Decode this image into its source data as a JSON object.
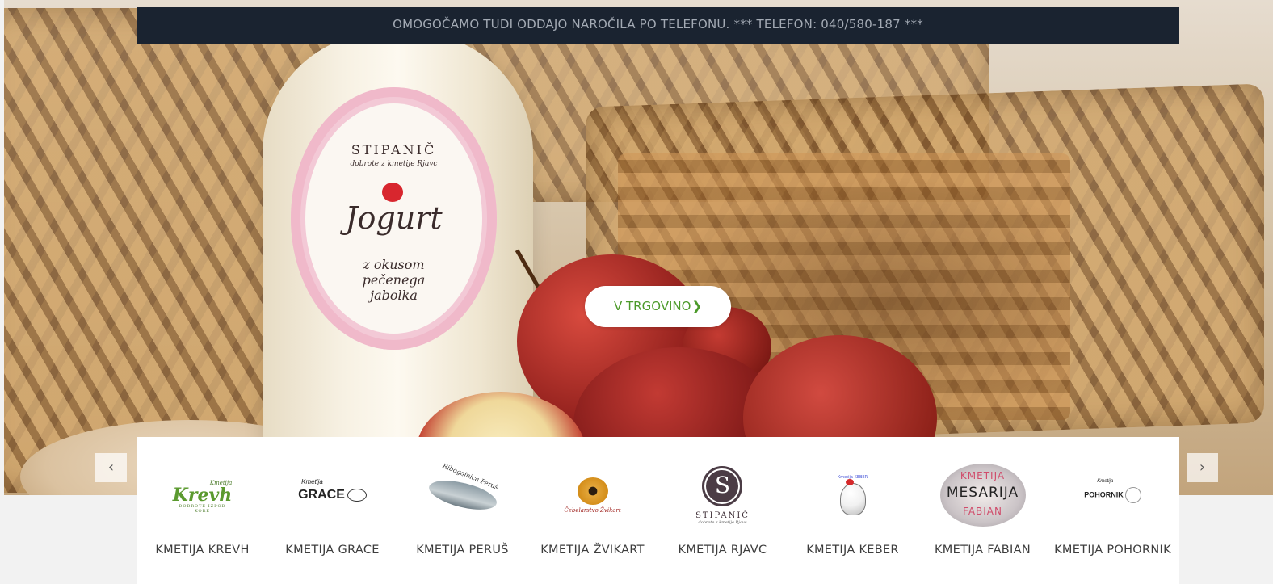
{
  "banner": {
    "text": "OMOGOČAMO TUDI ODDAJO NAROČILA PO TELEFONU. *** TELEFON: 040/580-187 ***"
  },
  "hero": {
    "label_brand": "STIPANIČ",
    "label_sub": "dobrote z kmetije Rjavc",
    "label_main": "Jogurt",
    "label_desc_1": "z okusom",
    "label_desc_2": "pečenega",
    "label_desc_3": "jabolka",
    "cta_label": "V TRGOVINO",
    "cta_icon": "chevron-right-icon"
  },
  "carousel": {
    "prev_label": "‹",
    "next_label": "›"
  },
  "brands": [
    {
      "name": "KMETIJA KREVH",
      "logo_word": "Krevh",
      "logo_small": "Kmetija",
      "logo_tag": "DOBROTE IZPOD KORE"
    },
    {
      "name": "KMETIJA GRACE",
      "logo_word": "GRACE",
      "logo_small": "Kmetija"
    },
    {
      "name": "KMETIJA PERUŠ",
      "logo_word": "Ribogojnica Peruš"
    },
    {
      "name": "KMETIJA ŽVIKART",
      "logo_word": "Čebelarstvo Žvikart"
    },
    {
      "name": "KMETIJA RJAVC",
      "logo_word": "STIPANIČ",
      "logo_letter": "S",
      "logo_tag": "dobrote z kmetije Rjavc"
    },
    {
      "name": "KMETIJA KEBER",
      "logo_small": "Kmetija KEBER"
    },
    {
      "name": "KMETIJA FABIAN",
      "logo_top": "KMETIJA",
      "logo_word": "MESARIJA",
      "logo_bottom": "FABIAN"
    },
    {
      "name": "KMETIJA POHORNIK",
      "logo_word": "POHORNIK",
      "logo_small": "Kmetija"
    }
  ],
  "colors": {
    "banner_bg": "#1a2330",
    "banner_text": "#a3aab4",
    "cta_text": "#4c9a2a",
    "page_bg": "#f2f2f2"
  }
}
